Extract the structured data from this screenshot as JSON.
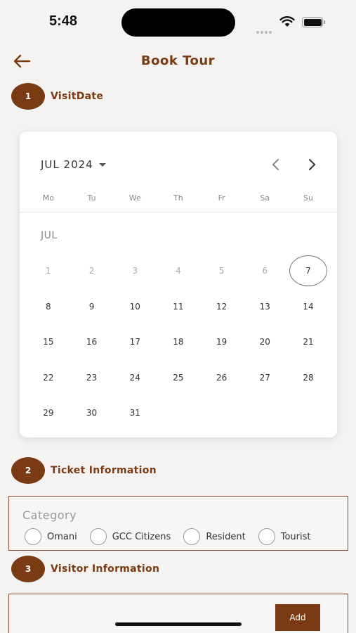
{
  "status_bar": {
    "time": "5:48"
  },
  "header": {
    "title": "Book Tour"
  },
  "steps": [
    {
      "number": "1",
      "label": "VisitDate"
    },
    {
      "number": "2",
      "label": "Ticket Information"
    },
    {
      "number": "3",
      "label": "Visitor Information"
    }
  ],
  "calendar": {
    "month_year": "JUL 2024",
    "weekdays": [
      "Mo",
      "Tu",
      "We",
      "Th",
      "Fr",
      "Sa",
      "Su"
    ],
    "month_label": "JUL",
    "weeks": [
      [
        "1",
        "2",
        "3",
        "4",
        "5",
        "6",
        "7"
      ],
      [
        "8",
        "9",
        "10",
        "11",
        "12",
        "13",
        "14"
      ],
      [
        "15",
        "16",
        "17",
        "18",
        "19",
        "20",
        "21"
      ],
      [
        "22",
        "23",
        "24",
        "25",
        "26",
        "27",
        "28"
      ],
      [
        "29",
        "30",
        "31",
        "",
        "",
        "",
        ""
      ]
    ],
    "today": "7"
  },
  "ticket": {
    "category_label": "Category",
    "options": [
      "Omani",
      "GCC Citizens",
      "Resident",
      "Tourist"
    ]
  },
  "visitor": {
    "add_label": "Add"
  },
  "colors": {
    "accent": "#7a3a14",
    "background": "#f4f3f1"
  }
}
